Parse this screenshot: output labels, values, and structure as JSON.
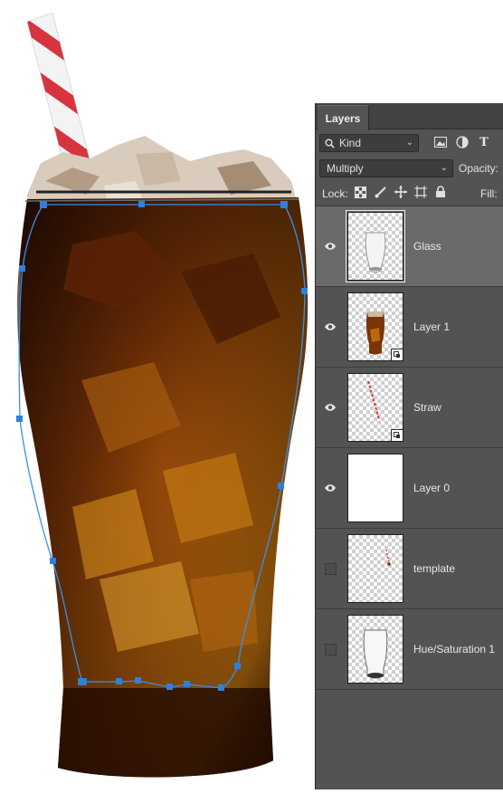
{
  "layers_panel": {
    "tab": "Layers",
    "filter": {
      "label": "Kind",
      "filter_icons": [
        "image-filter-icon",
        "adjustment-filter-icon",
        "type-filter-icon"
      ]
    },
    "blend_mode": "Multiply",
    "opacity_label": "Opacity:",
    "lock_label": "Lock:",
    "fill_label": "Fill:",
    "layers": [
      {
        "name": "Glass",
        "visible": true,
        "selected": true
      },
      {
        "name": "Layer 1",
        "visible": true,
        "selected": false,
        "smart_object": true
      },
      {
        "name": "Straw",
        "visible": true,
        "selected": false,
        "smart_object": true
      },
      {
        "name": "Layer 0",
        "visible": true,
        "selected": false
      },
      {
        "name": "template",
        "visible": false,
        "selected": false
      },
      {
        "name": "Hue/Saturation 1",
        "visible": false,
        "selected": false
      }
    ]
  },
  "canvas": {
    "description_colors": {
      "cola_dark": "#2a0a02",
      "cola_mid": "#7a3407",
      "cola_light": "#c8780f",
      "path": "#3a8ee6",
      "straw_red": "#d6343f"
    }
  }
}
